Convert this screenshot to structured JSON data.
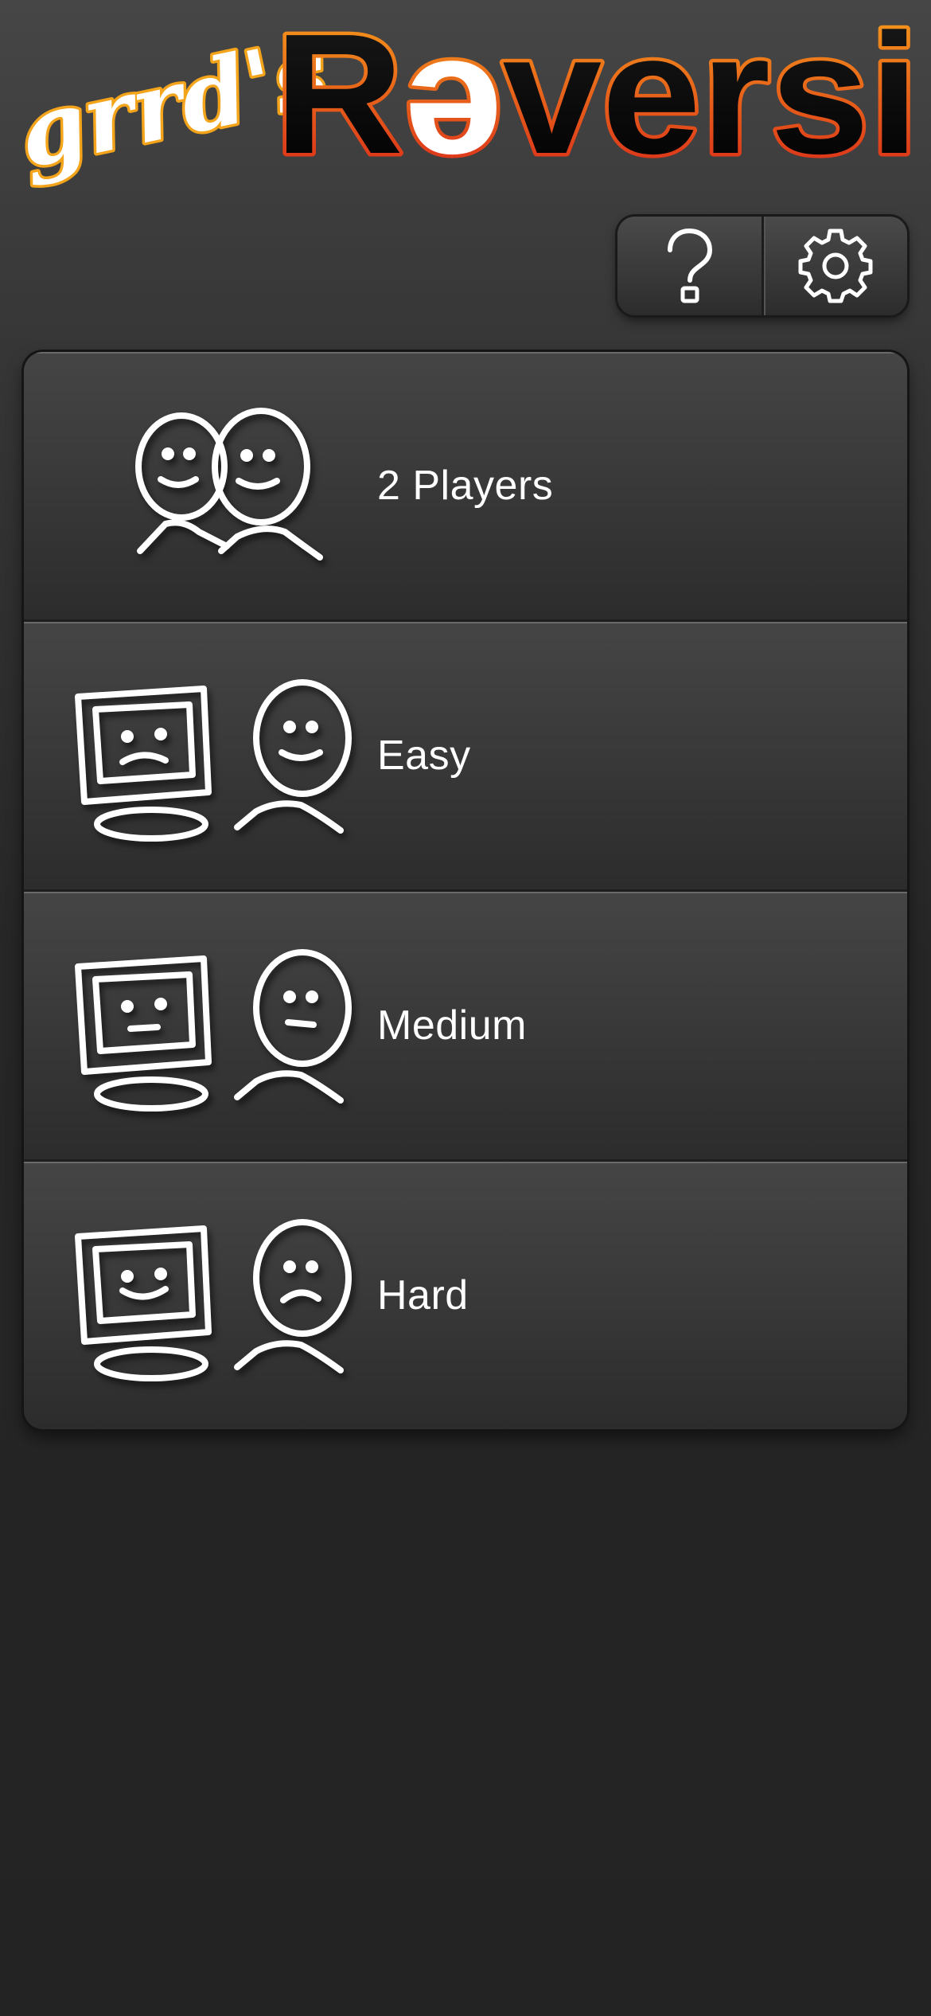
{
  "logo": {
    "prefix": "grrd's",
    "title_part1": "R",
    "title_part2": "ə",
    "title_part3": "versi",
    "colors": {
      "prefix_fill": "#ffffff",
      "prefix_outline": "#f3a41a",
      "title_fill": "#000000",
      "title_outline_top": "#f7a21b",
      "title_outline_bottom": "#d8251a",
      "inverted_fill": "#ffffff"
    }
  },
  "toolbar": {
    "help_icon": "question-mark-icon",
    "settings_icon": "gear-icon"
  },
  "menu": {
    "items": [
      {
        "label": "2 Players",
        "icon": "two-players-icon"
      },
      {
        "label": "Easy",
        "icon": "computer-easy-icon"
      },
      {
        "label": "Medium",
        "icon": "computer-medium-icon"
      },
      {
        "label": "Hard",
        "icon": "computer-hard-icon"
      }
    ]
  },
  "colors": {
    "background_top": "#464646",
    "background_bottom": "#232323",
    "text": "#ffffff"
  }
}
